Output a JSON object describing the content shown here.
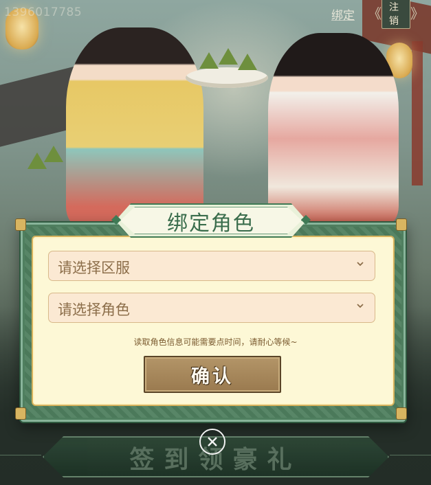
{
  "header": {
    "phone_number": "1396017785",
    "bind_link": "绑定",
    "logout_button": "注销"
  },
  "modal": {
    "title": "绑定角色",
    "server_select": {
      "placeholder": "请选择区服"
    },
    "role_select": {
      "placeholder": "请选择角色"
    },
    "hint": "读取角色信息可能需要点时间，请耐心等候~",
    "confirm_button": "确认"
  },
  "banner": {
    "text": "签到领豪礼"
  },
  "icons": [
    "chevron-down-icon",
    "close-circle-icon"
  ],
  "colors": {
    "modal_frame": "#4f7f5f",
    "modal_panel": "#fdf8d6",
    "select_bg": "#fbe9d3",
    "title_text": "#3a6d4c",
    "confirm_button": "#a98a5c"
  }
}
